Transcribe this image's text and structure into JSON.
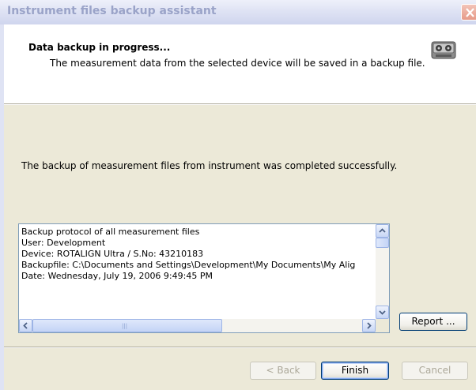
{
  "window": {
    "title": "Instrument files backup assistant"
  },
  "header": {
    "title": "Data backup in progress...",
    "subtitle": "The measurement data from the selected device will be saved in a backup file.",
    "icon": "tape-drive-icon"
  },
  "status": {
    "message": "The backup of measurement files from instrument was completed successfully."
  },
  "log": {
    "lines": [
      "Backup protocol of all measurement files",
      "User: Development",
      "Device: ROTALIGN Ultra / S.No: 43210183",
      "Backupfile: C:\\Documents and Settings\\Development\\My Documents\\My Alig",
      "Date: Wednesday, July 19, 2006 9:49:45 PM"
    ]
  },
  "buttons": {
    "report": "Report ...",
    "back": "< Back",
    "finish": "Finish",
    "cancel": "Cancel"
  },
  "colors": {
    "face": "#ece9d8",
    "border_blue": "#003c74",
    "title_text": "#9aa3c8"
  }
}
